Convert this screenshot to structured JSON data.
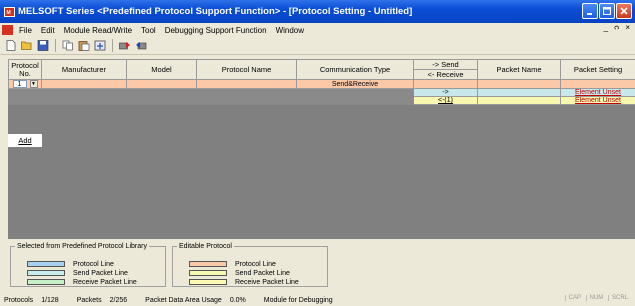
{
  "window": {
    "title": "MELSOFT Series <Predefined Protocol Support Function> - [Protocol Setting - Untitled]",
    "app_icon": "MELSOFT",
    "mdi_controls": "_ ᴒ ×"
  },
  "menubar": {
    "items": [
      "File",
      "Edit",
      "Module Read/Write",
      "Tool",
      "Debugging Support Function",
      "Window"
    ]
  },
  "toolbar": {
    "icons": [
      "new-icon",
      "open-icon",
      "save-icon",
      "copy-icon",
      "paste-icon",
      "read-icon",
      "write-icon",
      "verify-icon"
    ]
  },
  "table": {
    "headers": {
      "protocol_no": "Protocol No.",
      "manufacturer": "Manufacturer",
      "model": "Model",
      "protocol_name": "Protocol Name",
      "communication_type": "Communication Type",
      "send": "-> Send",
      "receive": "<- Receive",
      "packet_name": "Packet Name",
      "packet_setting": "Packet Setting"
    },
    "row1": {
      "protocol_no": "1",
      "communication_type": "Send&Receive"
    },
    "row2": {
      "direction": "->",
      "packet_setting": "Element Unset"
    },
    "row3": {
      "direction": "<-(1)",
      "packet_setting": "Element Unset"
    },
    "add_label": "Add"
  },
  "legend": {
    "predefined": {
      "title": "Selected from Predefined Protocol Library",
      "items": [
        "Protocol Line",
        "Send Packet Line",
        "Receive Packet Line"
      ],
      "colors": [
        "#a8d0f0",
        "#c8ecec",
        "#c8f0c8"
      ]
    },
    "editable": {
      "title": "Editable Protocol",
      "items": [
        "Protocol Line",
        "Send Packet Line",
        "Receive Packet Line"
      ],
      "colors": [
        "#fbc8a8",
        "#f8f8b0",
        "#f8f8b0"
      ]
    }
  },
  "status": {
    "protocols_label": "Protocols",
    "protocols_value": "1/128",
    "packets_label": "Packets",
    "packets_value": "2/256",
    "data_area_label": "Packet Data Area Usage",
    "data_area_value": "0.0%",
    "mode": "Module for Debugging",
    "indicators": [
      "CAP",
      "NUM",
      "SCRL"
    ]
  }
}
